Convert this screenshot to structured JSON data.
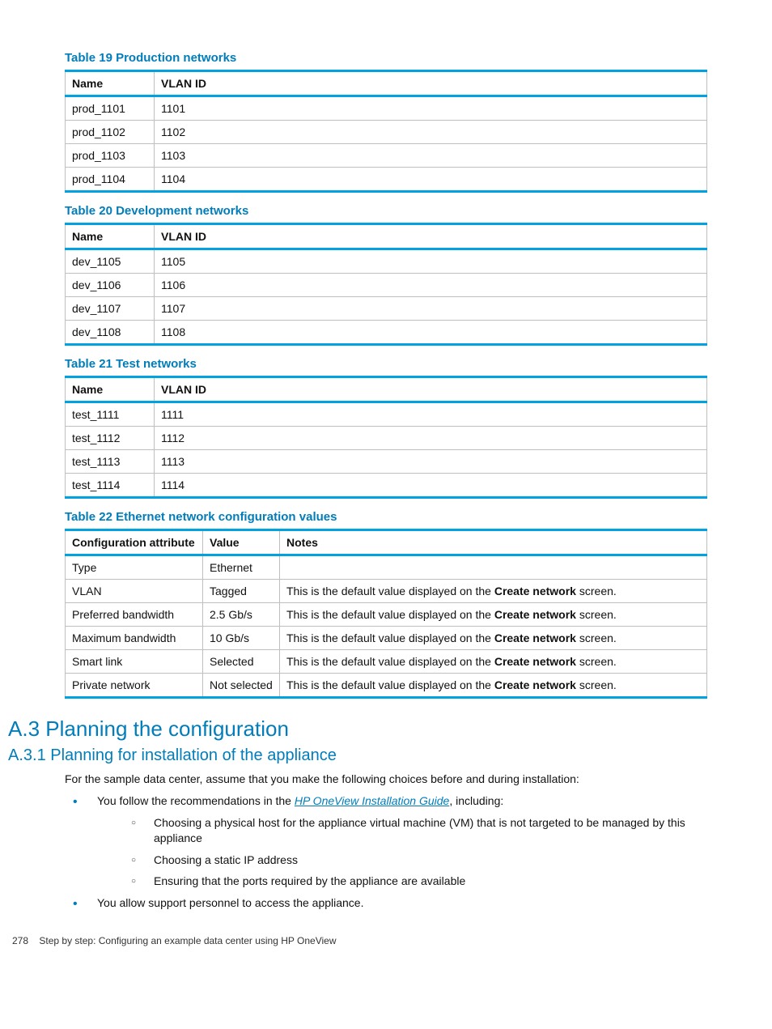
{
  "tables": {
    "t19": {
      "caption": "Table 19 Production networks",
      "headers": [
        "Name",
        "VLAN ID"
      ],
      "rows": [
        [
          "prod_1101",
          "1101"
        ],
        [
          "prod_1102",
          "1102"
        ],
        [
          "prod_1103",
          "1103"
        ],
        [
          "prod_1104",
          "1104"
        ]
      ]
    },
    "t20": {
      "caption": "Table 20 Development networks",
      "headers": [
        "Name",
        "VLAN ID"
      ],
      "rows": [
        [
          "dev_1105",
          "1105"
        ],
        [
          "dev_1106",
          "1106"
        ],
        [
          "dev_1107",
          "1107"
        ],
        [
          "dev_1108",
          "1108"
        ]
      ]
    },
    "t21": {
      "caption": "Table 21 Test networks",
      "headers": [
        "Name",
        "VLAN ID"
      ],
      "rows": [
        [
          "test_1111",
          "1111"
        ],
        [
          "test_1112",
          "1112"
        ],
        [
          "test_1113",
          "1113"
        ],
        [
          "test_1114",
          "1114"
        ]
      ]
    },
    "t22": {
      "caption": "Table 22 Ethernet network configuration values",
      "headers": [
        "Configuration attribute",
        "Value",
        "Notes"
      ],
      "rows": [
        {
          "attr": "Type",
          "val": "Ethernet",
          "note_pre": "",
          "note_bold": "",
          "note_post": ""
        },
        {
          "attr": "VLAN",
          "val": "Tagged",
          "note_pre": "This is the default value displayed on the ",
          "note_bold": "Create network",
          "note_post": " screen."
        },
        {
          "attr": "Preferred bandwidth",
          "val": "2.5 Gb/s",
          "note_pre": "This is the default value displayed on the ",
          "note_bold": "Create network",
          "note_post": " screen."
        },
        {
          "attr": "Maximum bandwidth",
          "val": "10 Gb/s",
          "note_pre": "This is the default value displayed on the ",
          "note_bold": "Create network",
          "note_post": " screen."
        },
        {
          "attr": "Smart link",
          "val": "Selected",
          "note_pre": "This is the default value displayed on the ",
          "note_bold": "Create network",
          "note_post": " screen."
        },
        {
          "attr": "Private network",
          "val": "Not selected",
          "note_pre": "This is the default value displayed on the ",
          "note_bold": "Create network",
          "note_post": " screen."
        }
      ]
    }
  },
  "section": {
    "h2": "A.3 Planning the configuration",
    "h3": "A.3.1 Planning for installation of the appliance",
    "intro": "For the sample data center, assume that you make the following choices before and during installation:",
    "b1_pre": "You follow the recommendations in the ",
    "b1_link": "HP OneView Installation Guide",
    "b1_post": ", including:",
    "sub1": "Choosing a physical host for the appliance virtual machine (VM) that is not targeted to be managed by this appliance",
    "sub2": "Choosing a static IP address",
    "sub3": "Ensuring that the ports required by the appliance are available",
    "b2": "You allow support personnel to access the appliance."
  },
  "footer": {
    "page": "278",
    "title": "Step by step: Configuring an example data center using HP OneView"
  }
}
